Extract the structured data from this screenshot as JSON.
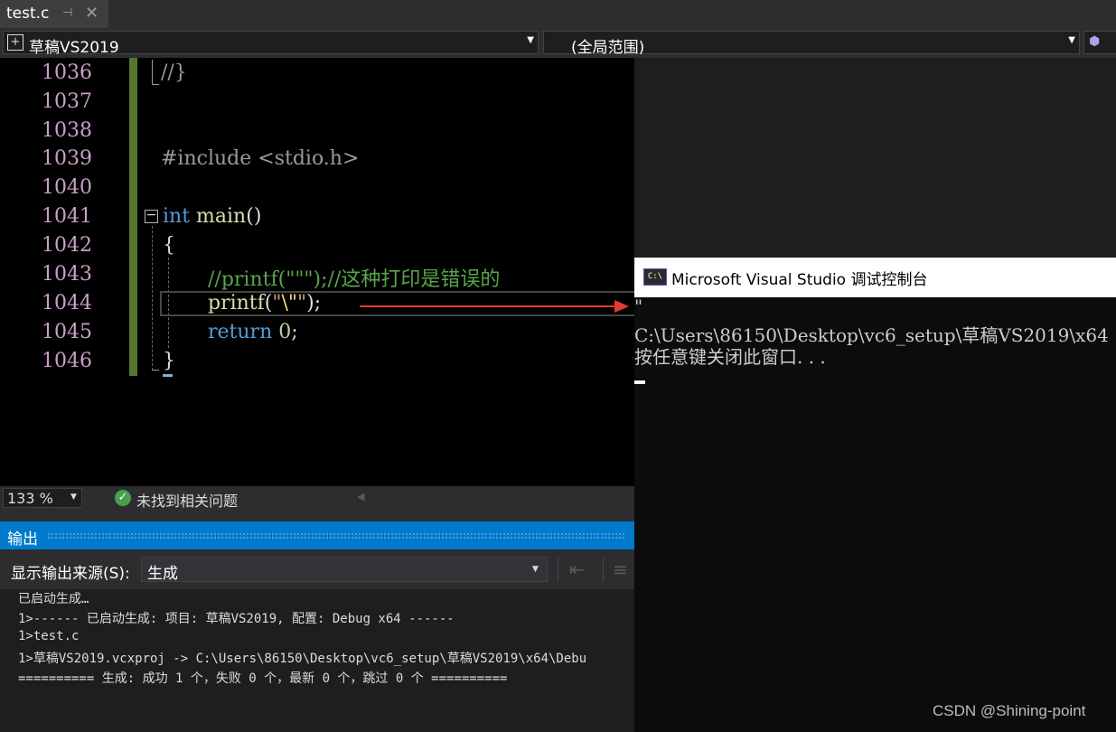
{
  "tab": {
    "title": "test.c",
    "pin_icon": "pin-icon",
    "close_icon": "close-icon"
  },
  "navbar": {
    "project": "草稿VS2019",
    "scope": "(全局范围)"
  },
  "editor": {
    "line_numbers": [
      "1036",
      "1037",
      "1038",
      "1039",
      "1040",
      "1041",
      "1042",
      "1043",
      "1044",
      "1045",
      "1046"
    ],
    "code": {
      "l1036": "//}",
      "l1039": "#include <stdio.h>",
      "l1041_kw": "int",
      "l1041_fn": " main",
      "l1041_p": "()",
      "l1042": "{",
      "l1043": "//printf(\"\"\");//这种打印是错误的",
      "l1044_fn": "printf",
      "l1044_open": "(",
      "l1044_q1": "\"",
      "l1044_esc": "\\\"",
      "l1044_q2": "\"",
      "l1044_close": ");",
      "l1045_kw": "return",
      "l1045_num": " 0",
      "l1045_semi": ";",
      "l1046": "}"
    },
    "accent_colors": {
      "change_bar": "#55772f",
      "arrow": "#e53935"
    }
  },
  "status": {
    "zoom": "133 %",
    "issues": "未找到相关问题"
  },
  "output": {
    "title": "输出",
    "source_label": "显示输出来源(S):",
    "source_value": "生成",
    "lines": [
      "已启动生成…",
      "1>------ 已启动生成: 项目: 草稿VS2019, 配置: Debug x64 ------",
      "1>test.c",
      "1>草稿VS2019.vcxproj -> C:\\Users\\86150\\Desktop\\vc6_setup\\草稿VS2019\\x64\\Debu",
      "========== 生成: 成功 1 个，失败 0 个，最新 0 个，跳过 0 个 =========="
    ]
  },
  "console": {
    "icon_text": "C:\\",
    "title": "Microsoft Visual Studio 调试控制台",
    "lines": [
      "\"",
      "C:\\Users\\86150\\Desktop\\vc6_setup\\草稿VS2019\\x64",
      "按任意键关闭此窗口. . ."
    ]
  },
  "watermark": "CSDN @Shining-point"
}
